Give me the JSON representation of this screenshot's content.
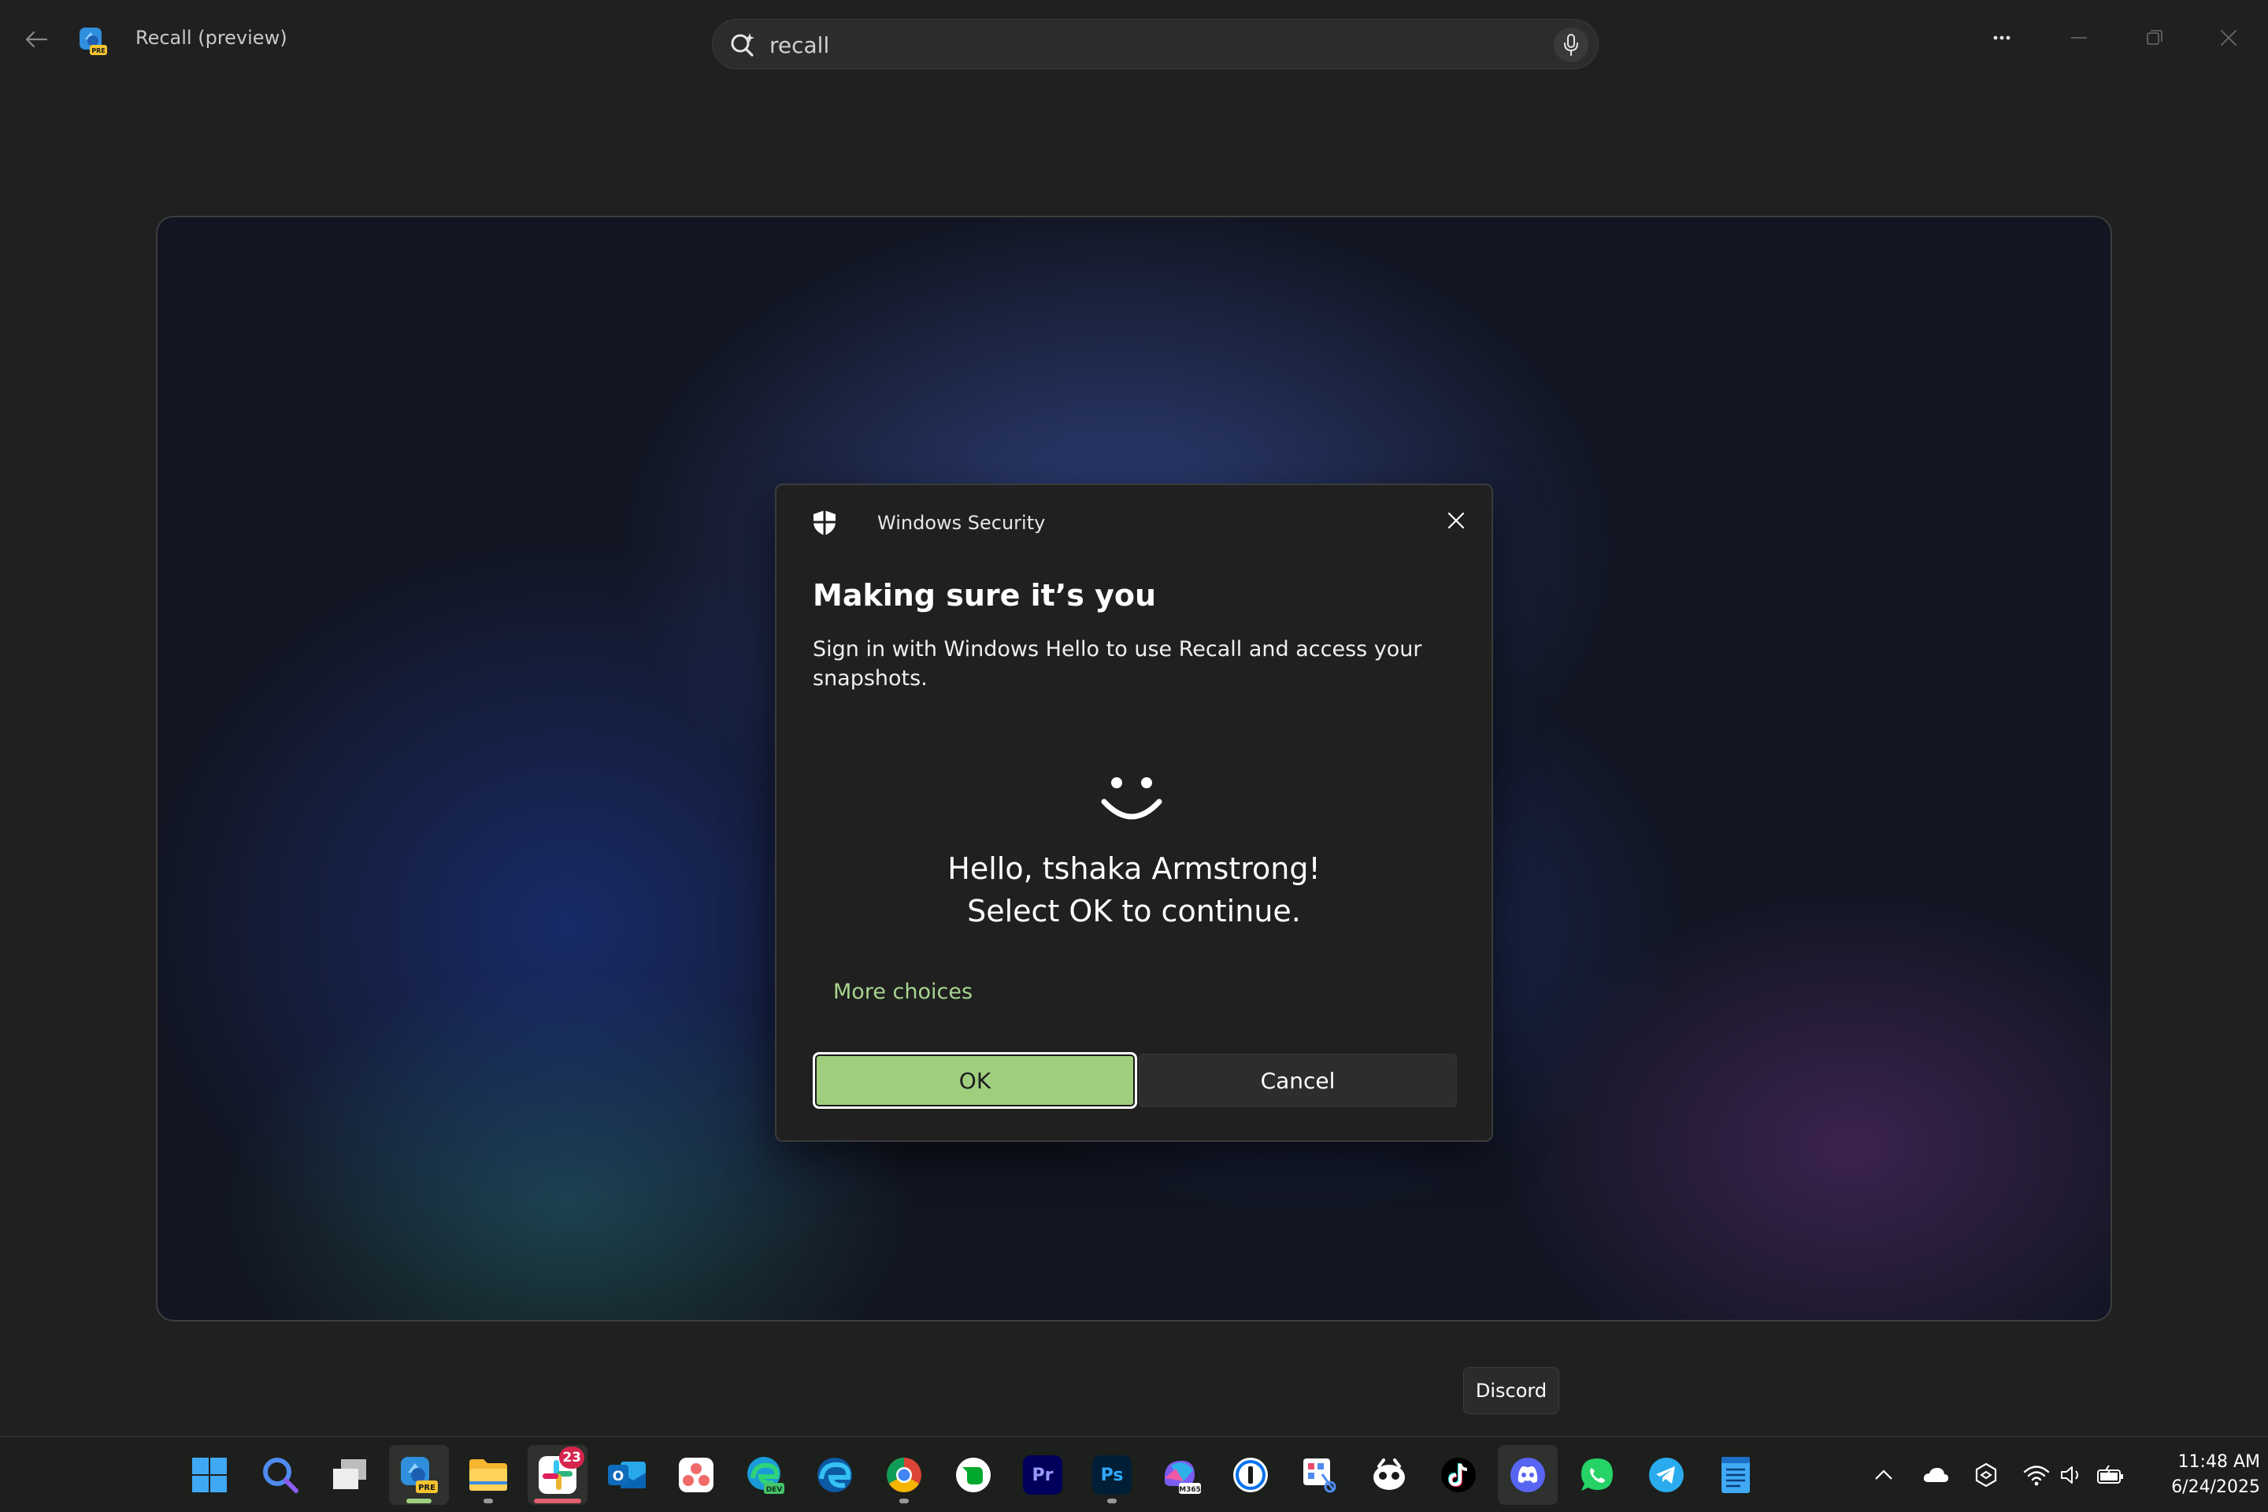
{
  "titlebar": {
    "app_title": "Recall (preview)",
    "app_badge": "PRE",
    "search_value": "recall",
    "back_icon": "back-arrow-icon",
    "search_icon": "copilot-search-icon",
    "mic_icon": "microphone-icon"
  },
  "dialog": {
    "app_name": "Windows Security",
    "title": "Making sure it’s you",
    "description": "Sign in with Windows Hello to use Recall and access your snapshots.",
    "greeting_line1": "Hello, tshaka Armstrong!",
    "greeting_line2": "Select OK to continue.",
    "more_choices": "More choices",
    "ok_label": "OK",
    "cancel_label": "Cancel",
    "accent": "#9fcf7e"
  },
  "tooltip": {
    "text": "Discord"
  },
  "taskbar": {
    "apps": [
      {
        "name": "Start",
        "icon": "windows-start-icon"
      },
      {
        "name": "Search",
        "icon": "search-icon"
      },
      {
        "name": "Task View",
        "icon": "task-view-icon"
      },
      {
        "name": "Recall (preview)",
        "icon": "recall-icon",
        "badge": "PRE",
        "active": true
      },
      {
        "name": "File Explorer",
        "icon": "file-explorer-icon"
      },
      {
        "name": "Slack",
        "icon": "slack-icon",
        "badge": "23",
        "active": true
      },
      {
        "name": "Outlook",
        "icon": "outlook-icon",
        "label": "O"
      },
      {
        "name": "Asana",
        "icon": "asana-icon"
      },
      {
        "name": "Edge Dev",
        "icon": "edge-dev-icon",
        "badge": "DEV"
      },
      {
        "name": "Edge",
        "icon": "edge-icon"
      },
      {
        "name": "Chrome",
        "icon": "chrome-icon"
      },
      {
        "name": "Evernote",
        "icon": "evernote-icon"
      },
      {
        "name": "Premiere Pro",
        "icon": "premiere-pro-icon",
        "label": "Pr"
      },
      {
        "name": "Photoshop",
        "icon": "photoshop-icon",
        "label": "Ps"
      },
      {
        "name": "Microsoft 365 Copilot",
        "icon": "m365-copilot-icon",
        "badge": "M365"
      },
      {
        "name": "1Password",
        "icon": "onepassword-icon"
      },
      {
        "name": "Snipping Tool",
        "icon": "snipping-tool-icon"
      },
      {
        "name": "Character app",
        "icon": "character-app-icon"
      },
      {
        "name": "TikTok",
        "icon": "tiktok-icon"
      },
      {
        "name": "Discord",
        "icon": "discord-icon",
        "active": true
      },
      {
        "name": "WhatsApp",
        "icon": "whatsapp-icon"
      },
      {
        "name": "Telegram",
        "icon": "telegram-icon"
      },
      {
        "name": "Notepad",
        "icon": "notepad-icon"
      }
    ],
    "tray": {
      "icons": [
        "chevron-up-icon",
        "onedrive-cloud-icon",
        "vpn-icon",
        "wifi-icon",
        "speaker-icon",
        "battery-icon"
      ],
      "time": "11:48 AM",
      "date": "6/24/2025"
    }
  }
}
